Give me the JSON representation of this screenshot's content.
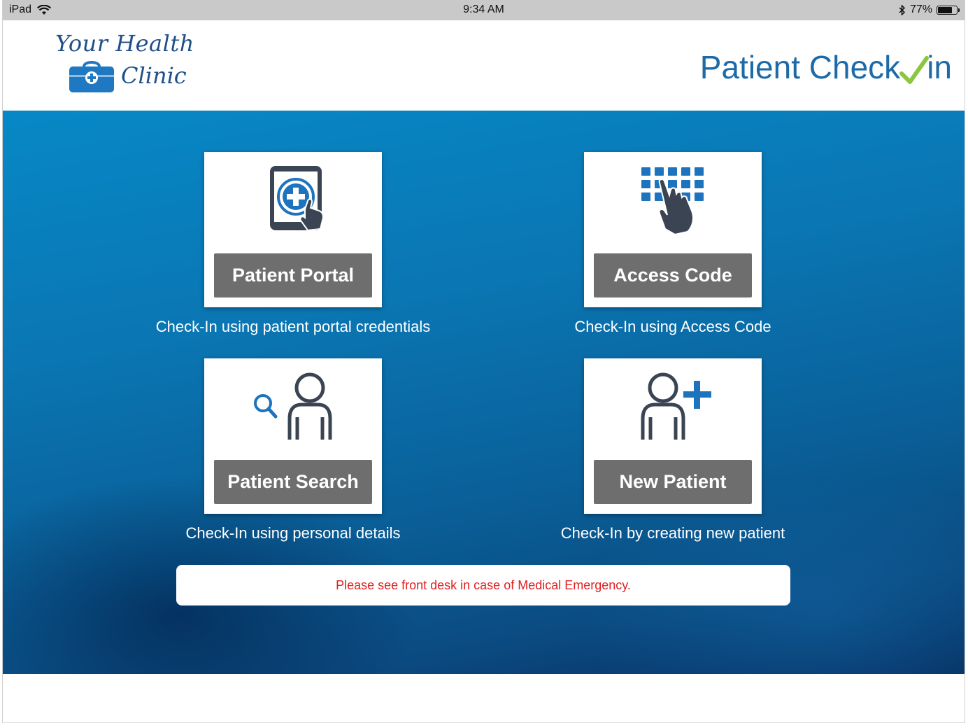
{
  "status_bar": {
    "device": "iPad",
    "time": "9:34 AM",
    "battery": "77%",
    "battery_level": 0.77
  },
  "header": {
    "left_logo": {
      "line1": "Your Health",
      "line2": "Clinic"
    },
    "right_logo": {
      "part1": "Patient Check",
      "part2": "in"
    }
  },
  "tiles": [
    {
      "label": "Patient Portal",
      "caption": "Check-In using patient portal credentials",
      "icon": "tablet-medical-touch-icon"
    },
    {
      "label": "Access Code",
      "caption": "Check-In using Access Code",
      "icon": "keypad-touch-icon"
    },
    {
      "label": "Patient Search",
      "caption": "Check-In using personal details",
      "icon": "person-search-icon"
    },
    {
      "label": "New Patient",
      "caption": "Check-In by creating new patient",
      "icon": "person-add-icon"
    }
  ],
  "notice": "Please see front desk in case of Medical Emergency.",
  "colors": {
    "brand_dark": "#1f4f88",
    "brand_blue": "#1d6aa8",
    "check_green": "#8cc63f",
    "button_gray": "#6e6e6e",
    "alert_red": "#e02020",
    "icon_blue": "#1e73be",
    "icon_dark": "#3b4452"
  }
}
